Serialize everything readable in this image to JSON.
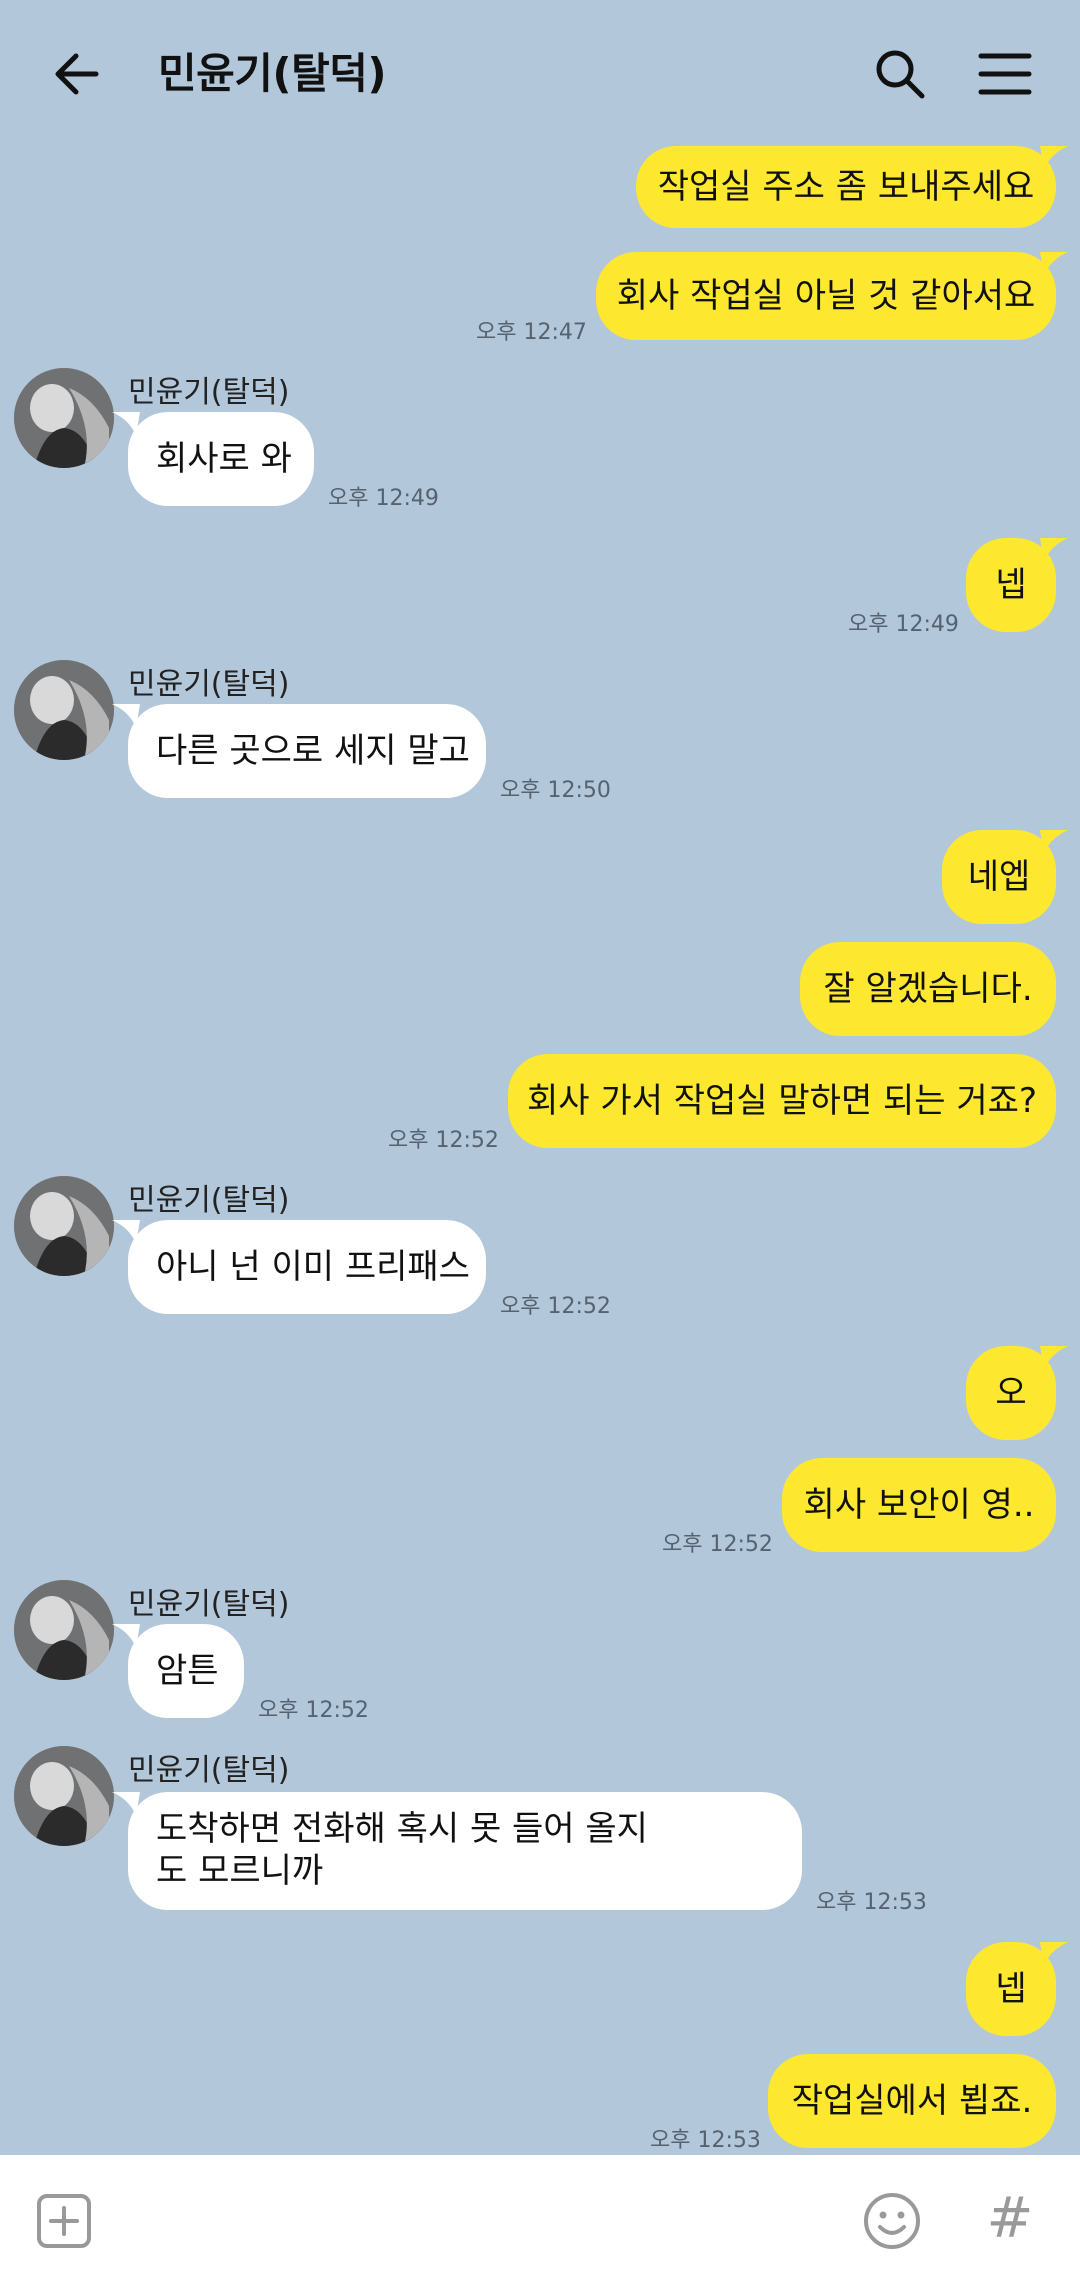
{
  "header": {
    "title": "민윤기(탈덕)",
    "back_icon": "arrow-left-icon",
    "search_icon": "search-icon",
    "menu_icon": "hamburger-menu-icon"
  },
  "colors": {
    "background": "#b2c7da",
    "my_bubble": "#fde82f",
    "other_bubble": "#ffffff"
  },
  "messages": [
    {
      "from": "me",
      "text": "작업실 주소 좀 보내주세요",
      "time": ""
    },
    {
      "from": "me",
      "text": "회사 작업실 아닐 것 같아서요",
      "time": "오후 12:47"
    },
    {
      "from": "other",
      "sender": "민윤기(탈덕)",
      "text": "회사로 와",
      "time": "오후 12:49"
    },
    {
      "from": "me",
      "text": "넵",
      "time": "오후 12:49"
    },
    {
      "from": "other",
      "sender": "민윤기(탈덕)",
      "text": "다른 곳으로 세지 말고",
      "time": "오후 12:50"
    },
    {
      "from": "me",
      "text": "네엡",
      "time": ""
    },
    {
      "from": "me",
      "text": "잘 알겠습니다.",
      "time": ""
    },
    {
      "from": "me",
      "text": "회사 가서 작업실 말하면 되는 거죠?",
      "time": "오후 12:52"
    },
    {
      "from": "other",
      "sender": "민윤기(탈덕)",
      "text": "아니 넌 이미 프리패스",
      "time": "오후 12:52"
    },
    {
      "from": "me",
      "text": "오",
      "time": ""
    },
    {
      "from": "me",
      "text": "회사 보안이 영..",
      "time": "오후 12:52"
    },
    {
      "from": "other",
      "sender": "민윤기(탈덕)",
      "text": "암튼",
      "time": "오후 12:52"
    },
    {
      "from": "other",
      "sender": "민윤기(탈덕)",
      "text": "도착하면 전화해 혹시 못 들어 올지도 모르니까",
      "time": "오후 12:53"
    },
    {
      "from": "me",
      "text": "넵",
      "time": ""
    },
    {
      "from": "me",
      "text": "작업실에서 뵙죠.",
      "time": "오후 12:53"
    }
  ],
  "input_bar": {
    "plus_icon": "plus-square-icon",
    "emoji_icon": "emoji-smile-icon",
    "hash_icon": "hashtag-icon",
    "hash_glyph": "#"
  }
}
